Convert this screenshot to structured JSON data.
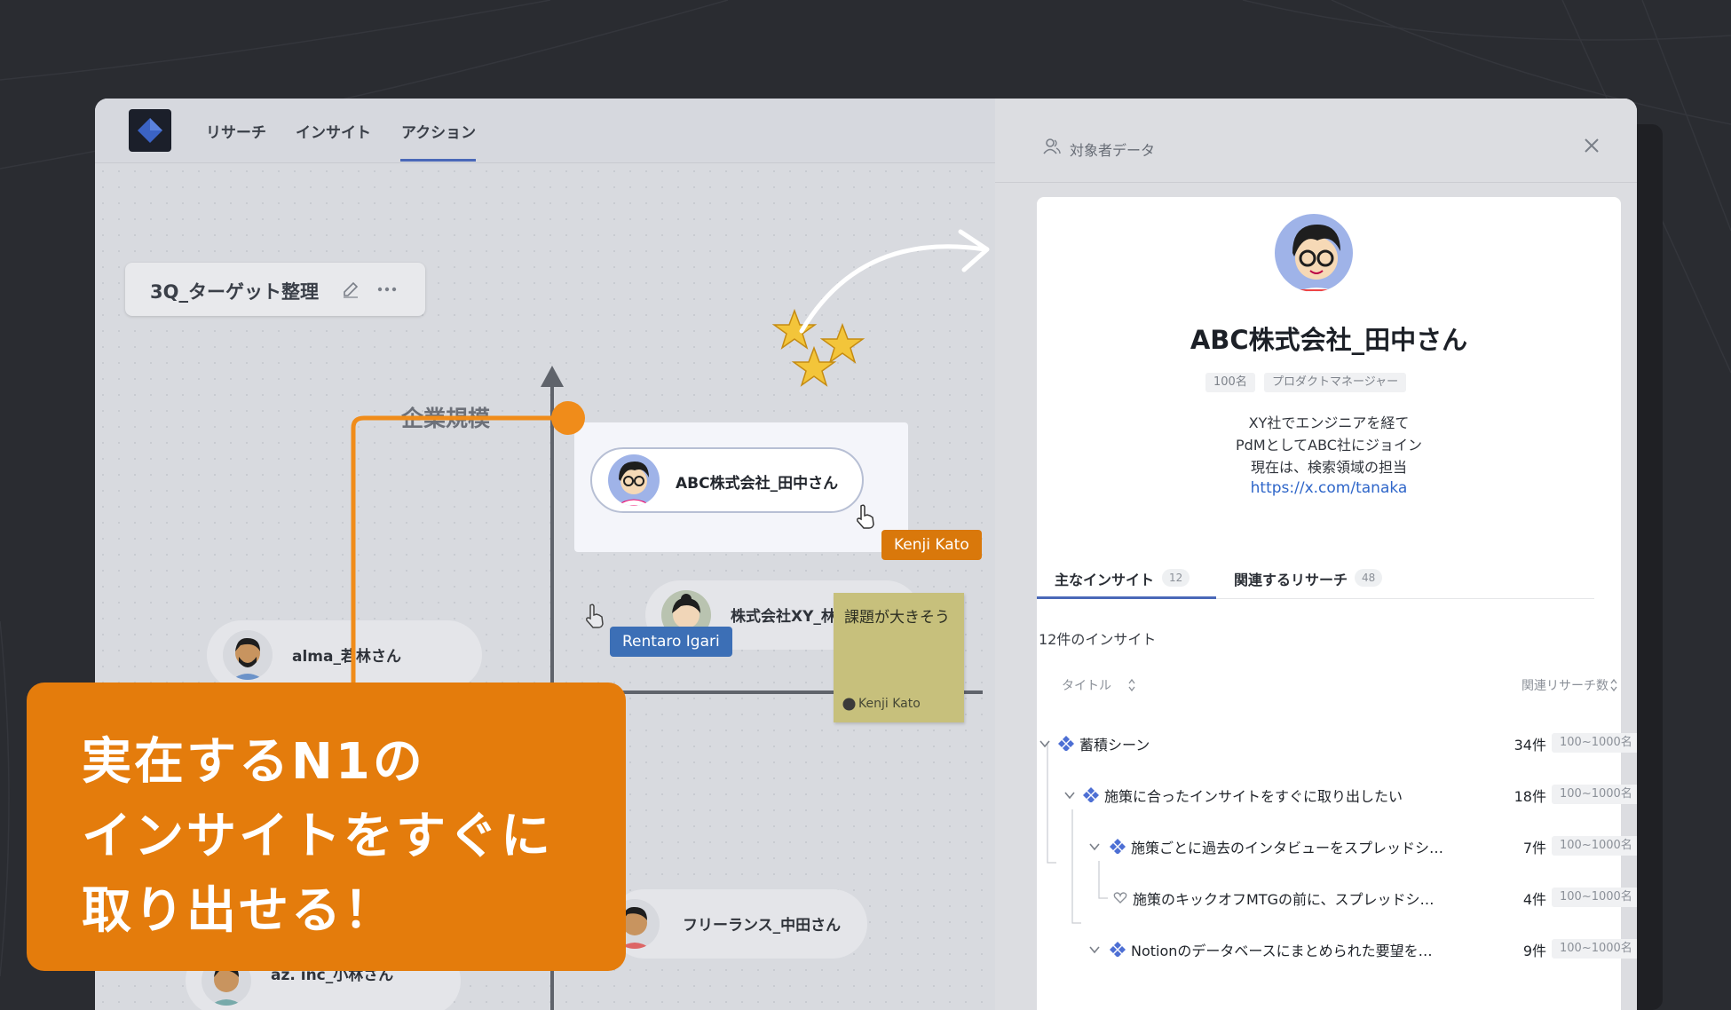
{
  "nav": {
    "items": [
      {
        "label": "リサーチ",
        "active": false
      },
      {
        "label": "インサイト",
        "active": false
      },
      {
        "label": "アクション",
        "active": true
      }
    ]
  },
  "board": {
    "title": "3Q_ターゲット整理",
    "axis_label": "企業規模",
    "persons": [
      {
        "name": "ABC株式会社_田中さん",
        "selected": true
      },
      {
        "name": "株式会社XY_林さん"
      },
      {
        "name": "alma_若林さん"
      },
      {
        "name": "フリーランス_中田さん"
      },
      {
        "name": "az. inc_小林さん"
      }
    ],
    "cursor_tags": {
      "kenji": "Kenji Kato",
      "rentaro": "Rentaro Igari"
    },
    "sticky": {
      "text": "課題が大きそう",
      "author": "Kenji Kato"
    }
  },
  "panel": {
    "header_label": "対象者データ",
    "profile": {
      "name": "ABC株式会社_田中さん",
      "chips": [
        "100名",
        "プロダクトマネージャー"
      ],
      "bio": [
        "XY社でエンジニアを経て",
        "PdMとしてABC社にジョイン",
        "現在は、検索領域の担当"
      ],
      "link": "https://x.com/tanaka"
    },
    "tabs": [
      {
        "label": "主なインサイト",
        "count": "12",
        "active": true
      },
      {
        "label": "関連するリサーチ",
        "count": "48",
        "active": false
      }
    ],
    "insight_count": "12件のインサイト",
    "columns": {
      "title": "タイトル",
      "related": "関連リサーチ数"
    },
    "rows": [
      {
        "title": "蓄積シーン",
        "count": "34件",
        "range": "100~1000名"
      },
      {
        "title": "施策に合ったインサイトをすぐに取り出したい",
        "count": "18件",
        "range": "100~1000名"
      },
      {
        "title": "施策ごとに過去のインタビューをスプレッドシ…",
        "count": "7件",
        "range": "100~1000名"
      },
      {
        "title": "施策のキックオフMTGの前に、スプレッドシ…",
        "count": "4件",
        "range": "100~1000名"
      },
      {
        "title": "Notionのデータベースにまとめられた要望を…",
        "count": "9件",
        "range": "100~1000名"
      }
    ]
  },
  "callout": {
    "lines": [
      "実在するN1の",
      "インサイトをすぐに",
      "取り出せる！"
    ]
  },
  "colors": {
    "accent": "#e47c0c",
    "primary": "#4a68b8",
    "link": "#2f66c9"
  }
}
